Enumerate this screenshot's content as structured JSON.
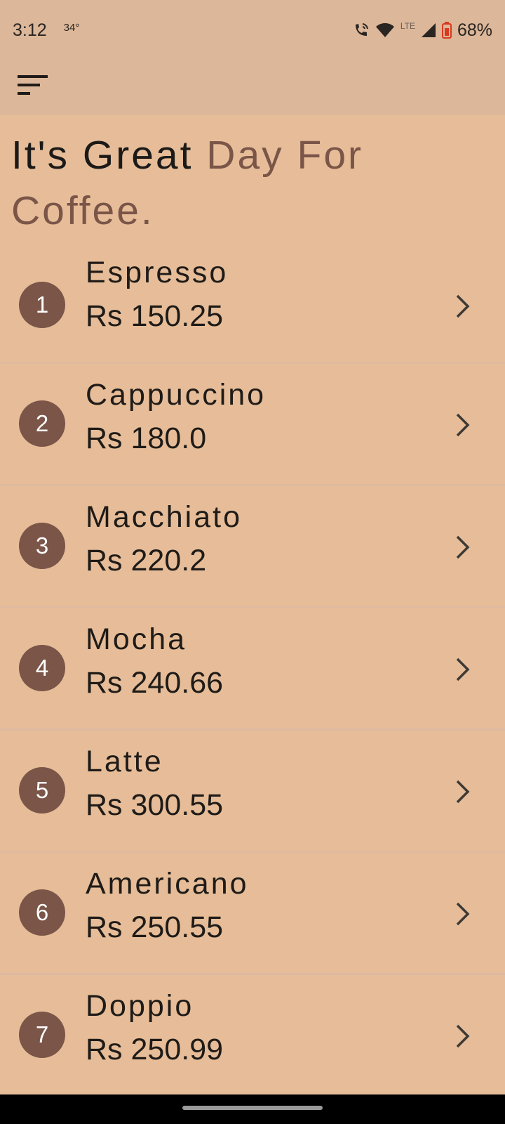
{
  "status_bar": {
    "time": "3:12",
    "temperature": "34°",
    "network": "LTE",
    "battery": "68%"
  },
  "app_bar": {
    "menu_icon": "sort-menu-icon"
  },
  "headline": {
    "part1": "It's Great ",
    "part2": "Day For Coffee."
  },
  "colors": {
    "background": "#e6bd98",
    "app_bar": "#dcb799",
    "accent": "#7a5548",
    "divider": "#dfb9a0"
  },
  "coffees": [
    {
      "index": "1",
      "name": "Espresso",
      "price": "Rs 150.25"
    },
    {
      "index": "2",
      "name": "Cappuccino",
      "price": "Rs 180.0"
    },
    {
      "index": "3",
      "name": "Macchiato",
      "price": "Rs 220.2"
    },
    {
      "index": "4",
      "name": "Mocha",
      "price": "Rs 240.66"
    },
    {
      "index": "5",
      "name": "Latte",
      "price": "Rs 300.55"
    },
    {
      "index": "6",
      "name": "Americano",
      "price": "Rs 250.55"
    },
    {
      "index": "7",
      "name": "Doppio",
      "price": "Rs 250.99"
    }
  ]
}
